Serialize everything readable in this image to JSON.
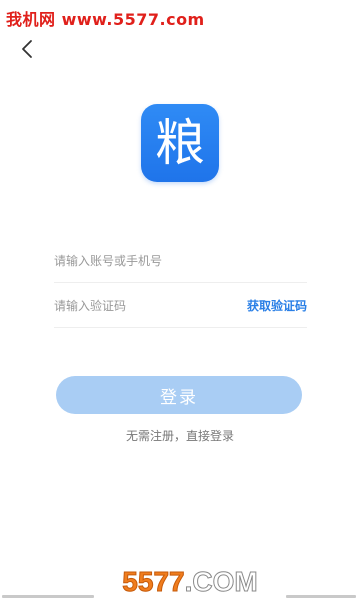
{
  "watermark": {
    "top_text": "我机网 www.5577.com",
    "bottom_brand": "5577",
    "bottom_suffix": ".COM"
  },
  "header": {
    "back_icon": "chevron-left-icon"
  },
  "logo": {
    "char": "粮",
    "color": "#2a7fe6"
  },
  "form": {
    "account_placeholder": "请输入账号或手机号",
    "account_value": "",
    "code_placeholder": "请输入验证码",
    "code_value": "",
    "get_code_label": "获取验证码"
  },
  "login": {
    "label": "登录",
    "no_register_text": "无需注册，直接登录"
  },
  "colors": {
    "accent": "#2a7fe6",
    "button_disabled": "#a9cdf4",
    "watermark_red": "#e0201b",
    "watermark_orange": "#f07d1e"
  }
}
